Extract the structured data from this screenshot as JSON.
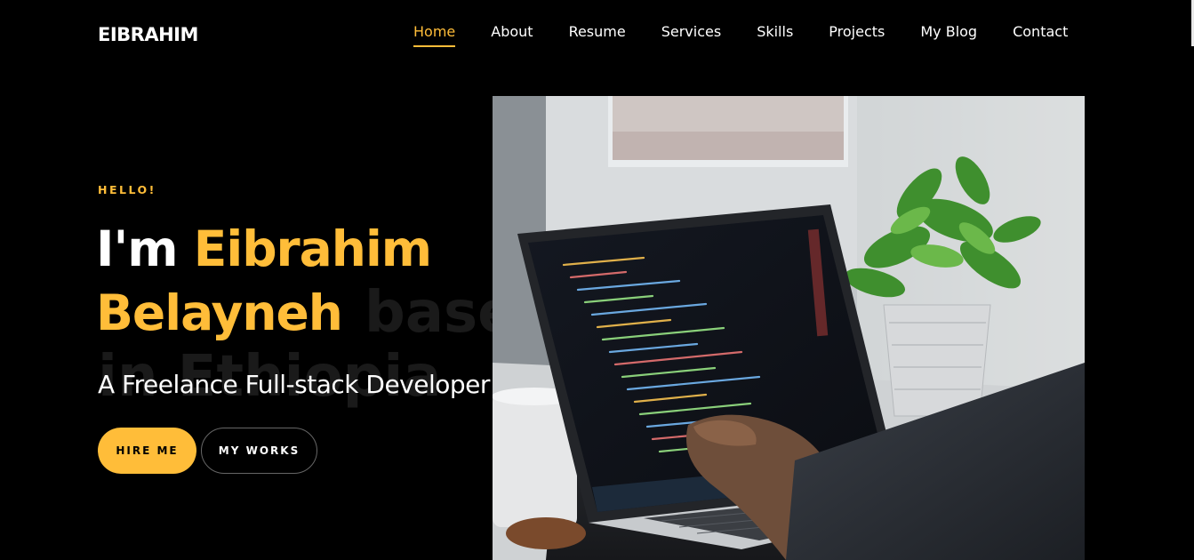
{
  "brand": "EIBRAHIM",
  "nav": {
    "items": [
      {
        "label": "Home",
        "active": true
      },
      {
        "label": "About"
      },
      {
        "label": "Resume"
      },
      {
        "label": "Services"
      },
      {
        "label": "Skills"
      },
      {
        "label": "Projects"
      },
      {
        "label": "My Blog"
      },
      {
        "label": "Contact"
      }
    ]
  },
  "hero": {
    "greeting": "HELLO!",
    "title_prefix": "I'm ",
    "title_name_line1": "Eibrahim",
    "title_name_line2": "Belayneh",
    "ghost_line1": "based",
    "ghost_line2": "in Ethiopia",
    "subtitle": "A Freelance Full-stack Developer",
    "primary_button": "HIRE ME",
    "secondary_button": "MY WORKS"
  },
  "colors": {
    "accent": "#ffbd39",
    "background": "#000000",
    "text": "#ffffff"
  },
  "icons": {
    "hero_image": "laptop-workspace-photo"
  }
}
